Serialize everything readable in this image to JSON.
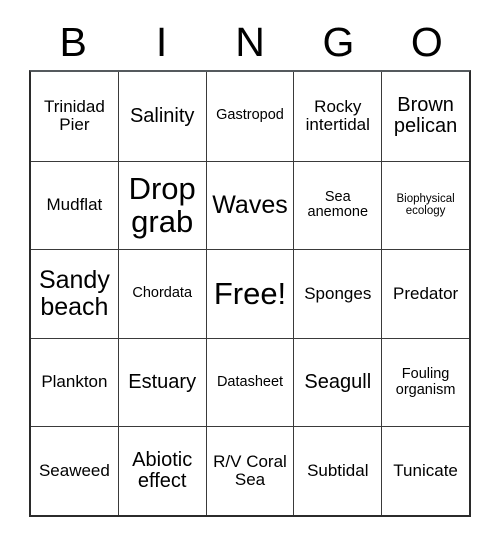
{
  "card": {
    "header_letters": [
      "B",
      "I",
      "N",
      "G",
      "O"
    ],
    "rows": [
      [
        {
          "text": "Trinidad Pier",
          "size": "sz-m"
        },
        {
          "text": "Salinity",
          "size": "sz-l"
        },
        {
          "text": "Gastropod",
          "size": "sz-s"
        },
        {
          "text": "Rocky intertidal",
          "size": "sz-m"
        },
        {
          "text": "Brown pelican",
          "size": "sz-l"
        }
      ],
      [
        {
          "text": "Mudflat",
          "size": "sz-m"
        },
        {
          "text": "Drop grab",
          "size": "sz-xxl"
        },
        {
          "text": "Waves",
          "size": "sz-xl"
        },
        {
          "text": "Sea anemone",
          "size": "sz-s"
        },
        {
          "text": "Biophysical ecology",
          "size": "sz-xs"
        }
      ],
      [
        {
          "text": "Sandy beach",
          "size": "sz-xl"
        },
        {
          "text": "Chordata",
          "size": "sz-s"
        },
        {
          "text": "Free!",
          "size": "sz-xxl"
        },
        {
          "text": "Sponges",
          "size": "sz-m"
        },
        {
          "text": "Predator",
          "size": "sz-m"
        }
      ],
      [
        {
          "text": "Plankton",
          "size": "sz-m"
        },
        {
          "text": "Estuary",
          "size": "sz-l"
        },
        {
          "text": "Datasheet",
          "size": "sz-s"
        },
        {
          "text": "Seagull",
          "size": "sz-l"
        },
        {
          "text": "Fouling organism",
          "size": "sz-s"
        }
      ],
      [
        {
          "text": "Seaweed",
          "size": "sz-m"
        },
        {
          "text": "Abiotic effect",
          "size": "sz-l"
        },
        {
          "text": "R/V Coral Sea",
          "size": "sz-m"
        },
        {
          "text": "Subtidal",
          "size": "sz-m"
        },
        {
          "text": "Tunicate",
          "size": "sz-m"
        }
      ]
    ]
  }
}
